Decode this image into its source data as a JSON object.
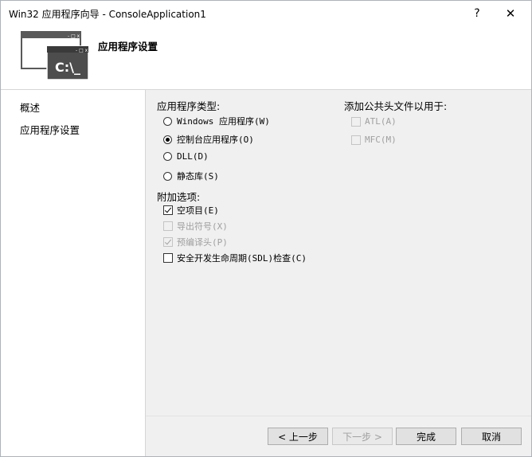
{
  "window": {
    "title": "Win32 应用程序向导 - ConsoleApplication1",
    "help_glyph": "?",
    "close_glyph": "✕"
  },
  "header": {
    "title": "应用程序设置",
    "icon_text": "C:\\_"
  },
  "sidebar": {
    "items": [
      {
        "label": "概述"
      },
      {
        "label": "应用程序设置"
      }
    ]
  },
  "app_type": {
    "label": "应用程序类型:",
    "options": [
      {
        "label": "Windows 应用程序(W)",
        "selected": false
      },
      {
        "label": "控制台应用程序(O)",
        "selected": true
      },
      {
        "label": "DLL(D)",
        "selected": false
      },
      {
        "label": "静态库(S)",
        "selected": false
      }
    ]
  },
  "extra_options": {
    "label": "附加选项:",
    "items": [
      {
        "label": "空项目(E)",
        "checked": true,
        "enabled": true
      },
      {
        "label": "导出符号(X)",
        "checked": false,
        "enabled": false
      },
      {
        "label": "预编译头(P)",
        "checked": true,
        "enabled": false
      },
      {
        "label": "安全开发生命周期(SDL)检查(C)",
        "checked": false,
        "enabled": true
      }
    ]
  },
  "common_headers": {
    "label": "添加公共头文件以用于:",
    "items": [
      {
        "label": "ATL(A)",
        "checked": false,
        "enabled": false
      },
      {
        "label": "MFC(M)",
        "checked": false,
        "enabled": false
      }
    ]
  },
  "buttons": {
    "prev": "< 上一步",
    "next": "下一步 >",
    "finish": "完成",
    "cancel": "取消"
  },
  "colors": {
    "panel": "#f0f0f0",
    "white": "#ffffff",
    "disabled_text": "#a0a0a0"
  }
}
